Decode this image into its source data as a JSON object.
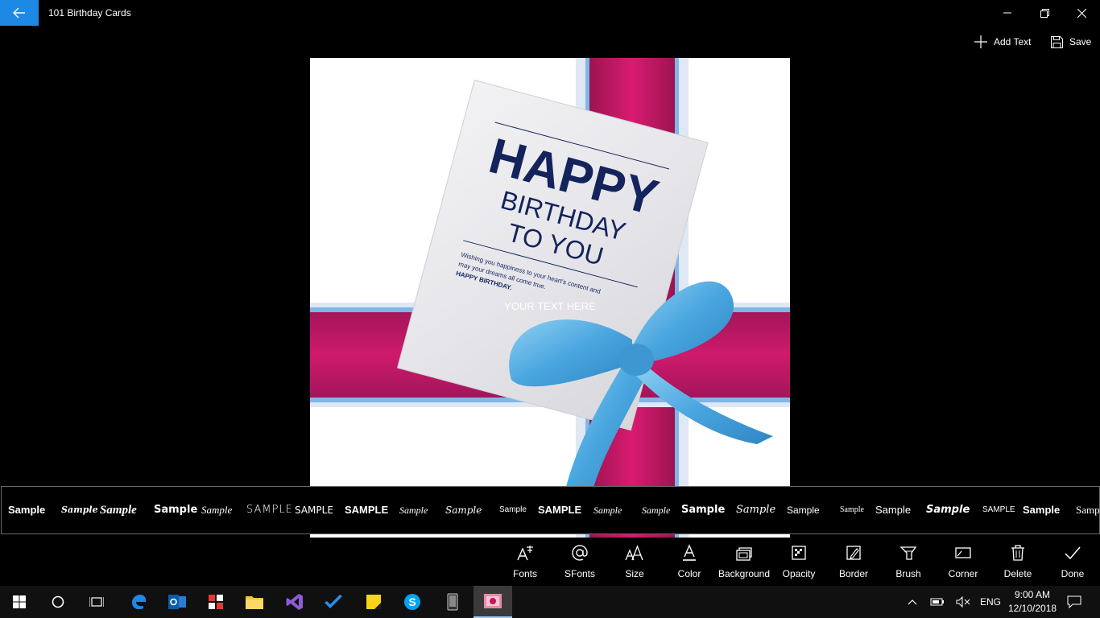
{
  "app": {
    "title": "101 Birthday Cards",
    "accent": "#1e88e5"
  },
  "commands": {
    "add_text": "Add Text",
    "save": "Save"
  },
  "card": {
    "line1": "HAPPY",
    "line2": "BIRTHDAY",
    "line3": "TO YOU",
    "message_1": "Wishing you happiness to your heart's content and",
    "message_2": "may your dreams all come true.",
    "message_3": "HAPPY BIRTHDAY.",
    "overlay_text": "YOUR TEXT HERE",
    "ribbon_color": "#c2185b",
    "bow_color": "#5ab4e8"
  },
  "font_samples": [
    "Sample",
    "Sample",
    "Sample",
    "Sample",
    "Sample",
    "SAMPLE",
    "SAMPLE",
    "SAMPLE",
    "Sample",
    "Sample",
    "Sample",
    "SAMPLE",
    "Sample",
    "Sample",
    "Sample",
    "Sample",
    "Sample",
    "Sample",
    "Sample",
    "Sample",
    "SAMPLE",
    "Sample",
    "Samp"
  ],
  "tools": [
    {
      "label": "Fonts",
      "icon": "fonts-icon"
    },
    {
      "label": "SFonts",
      "icon": "at-sign-icon"
    },
    {
      "label": "Size",
      "icon": "font-size-icon"
    },
    {
      "label": "Color",
      "icon": "font-color-icon"
    },
    {
      "label": "Background",
      "icon": "background-icon"
    },
    {
      "label": "Opacity",
      "icon": "opacity-icon"
    },
    {
      "label": "Border",
      "icon": "border-icon"
    },
    {
      "label": "Brush",
      "icon": "brush-icon"
    },
    {
      "label": "Corner",
      "icon": "corner-icon"
    },
    {
      "label": "Delete",
      "icon": "trash-icon"
    },
    {
      "label": "Done",
      "icon": "checkmark-icon"
    }
  ],
  "taskbar": {
    "language": "ENG",
    "time": "9:00 AM",
    "date": "12/10/2018"
  }
}
